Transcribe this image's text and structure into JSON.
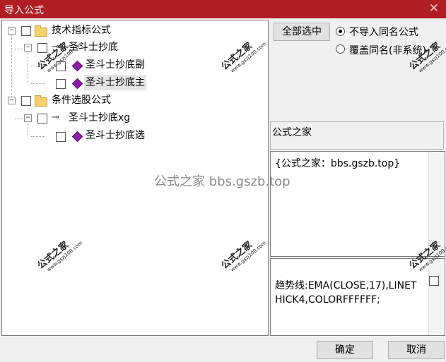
{
  "window": {
    "title": "导入公式",
    "close_glyph": "✕"
  },
  "tree": {
    "n1": "技术指标公式",
    "n1a": "圣斗士抄底",
    "n1a1": "圣斗士抄底副",
    "n1a2": "圣斗士抄底主",
    "n2": "条件选股公式",
    "n2a": "圣斗士抄底xg",
    "n2a1": "圣斗士抄底选"
  },
  "controls": {
    "select_all": "全部选中",
    "opt1": "不导入同名公式",
    "opt2": "覆盖同名(非系统)"
  },
  "info": {
    "name": "公式之家",
    "desc": "{公式之家：bbs.gszb.top}",
    "code": "趋势线:EMA(CLOSE,17),LINETHICK4,COLORFFFFFF;"
  },
  "footer": {
    "ok": "确定",
    "cancel": "取消"
  },
  "watermark": {
    "brand": "公式之家",
    "url": "www.gszj100.com",
    "center": "公式之家 bbs.gszb.top"
  },
  "colors": {
    "titlebar": "#b01e24",
    "folder": "#f3d06a",
    "gem": "#8e1ea8"
  }
}
